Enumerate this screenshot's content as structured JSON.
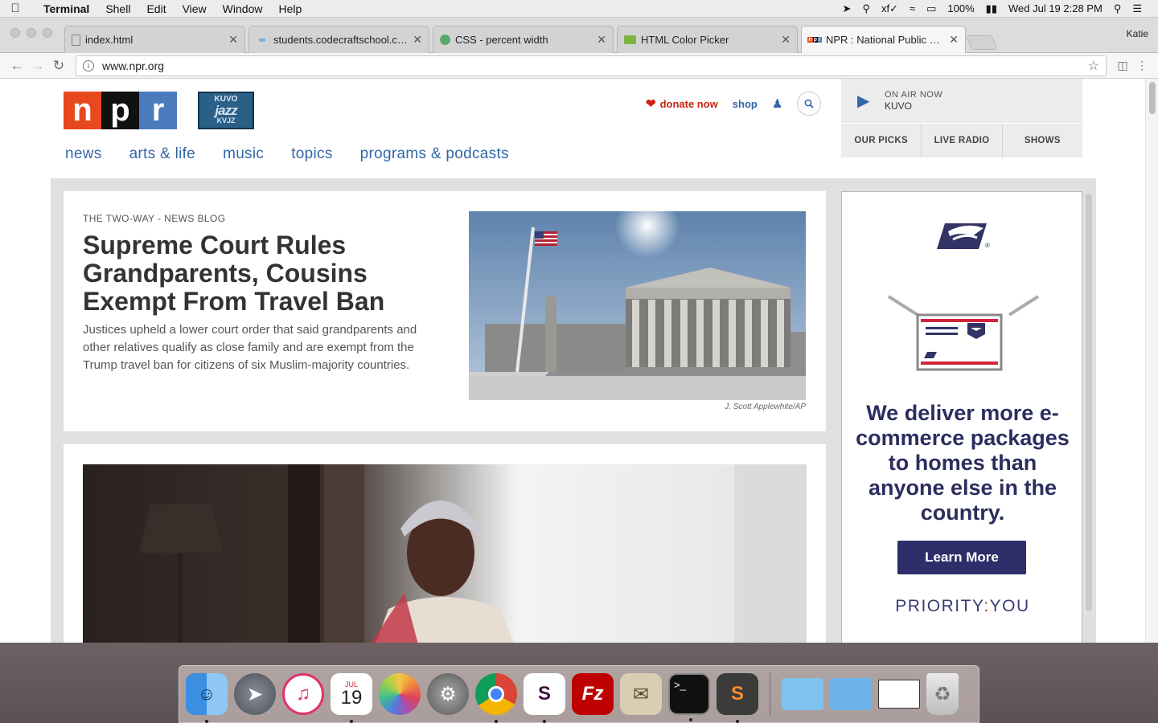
{
  "menubar": {
    "app_name": "Terminal",
    "items": [
      "Shell",
      "Edit",
      "View",
      "Window",
      "Help"
    ],
    "battery": "100%",
    "clock": "Wed Jul 19  2:28 PM"
  },
  "browser": {
    "tabs": [
      {
        "label": "index.html",
        "icon": "document-icon"
      },
      {
        "label": "students.codecraftschool.com",
        "icon": "codecraft-icon"
      },
      {
        "label": "CSS - percent width",
        "icon": "globe-icon"
      },
      {
        "label": "HTML Color Picker",
        "icon": "color-picker-icon"
      },
      {
        "label": "NPR : National Public Radio : N",
        "icon": "npr-icon"
      }
    ],
    "profile_name": "Katie",
    "url": "www.npr.org"
  },
  "npr": {
    "logo_letters": [
      "n",
      "p",
      "r"
    ],
    "station_logo": {
      "top": "KUVO",
      "middle": "jazz",
      "bottom": "KVJZ"
    },
    "nav": [
      "news",
      "arts & life",
      "music",
      "topics",
      "programs & podcasts"
    ],
    "donate_label": "donate now",
    "shop_label": "shop",
    "on_air_label": "ON AIR NOW",
    "on_air_station": "KUVO",
    "picks_nav": [
      "OUR PICKS",
      "LIVE RADIO",
      "SHOWS"
    ]
  },
  "story1": {
    "slug": "THE TWO-WAY - NEWS BLOG",
    "headline": "Supreme Court Rules Grandparents, Cousins Exempt From Travel Ban",
    "teaser": "Justices upheld a lower court order that said grandparents and other relatives qualify as close family and are exempt from the Trump travel ban for citizens of six Muslim-majority countries.",
    "photo_credit": "J. Scott Applewhite/AP"
  },
  "ad": {
    "headline": "We deliver more e-commerce packages to homes than anyone else in the country.",
    "cta": "Learn More",
    "tagline_left": "PRIORITY",
    "tagline_colon": ":",
    "tagline_right": "YOU"
  },
  "dock": [
    "finder-icon",
    "launchpad-icon",
    "itunes-icon",
    "calendar-icon",
    "photos-icon",
    "system-preferences-icon",
    "chrome-icon",
    "slack-icon",
    "filezilla-icon",
    "mail-icon",
    "terminal-icon",
    "sublime-text-icon",
    "folder-icon",
    "downloads-folder-icon",
    "window-preview-icon",
    "trash-icon"
  ],
  "calendar_month": "JUL",
  "calendar_day": "19"
}
